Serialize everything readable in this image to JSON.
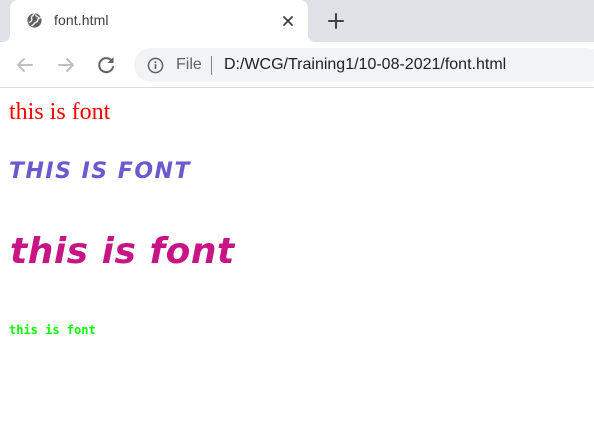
{
  "tab": {
    "title": "font.html",
    "favicon": "globe-icon",
    "close": "close-icon"
  },
  "toolbar": {
    "back": "arrow-left-icon",
    "forward": "arrow-right-icon",
    "reload": "reload-icon",
    "new_tab": "plus-icon"
  },
  "address_bar": {
    "info_icon": "info-icon",
    "scheme_label": "File",
    "url": "D:/WCG/Training1/10-08-2021/font.html"
  },
  "page": {
    "lines": [
      {
        "text": "this is font",
        "color": "#ff0000"
      },
      {
        "text": "THIS IS FONT",
        "color": "#6a5acd"
      },
      {
        "text": "this is font",
        "color": "#c71585"
      },
      {
        "text": "this is font",
        "color": "#00ff00"
      }
    ]
  },
  "colors": {
    "tabstrip": "#dee1e6",
    "omnibox": "#f1f3f4",
    "icon": "#5f6368"
  }
}
